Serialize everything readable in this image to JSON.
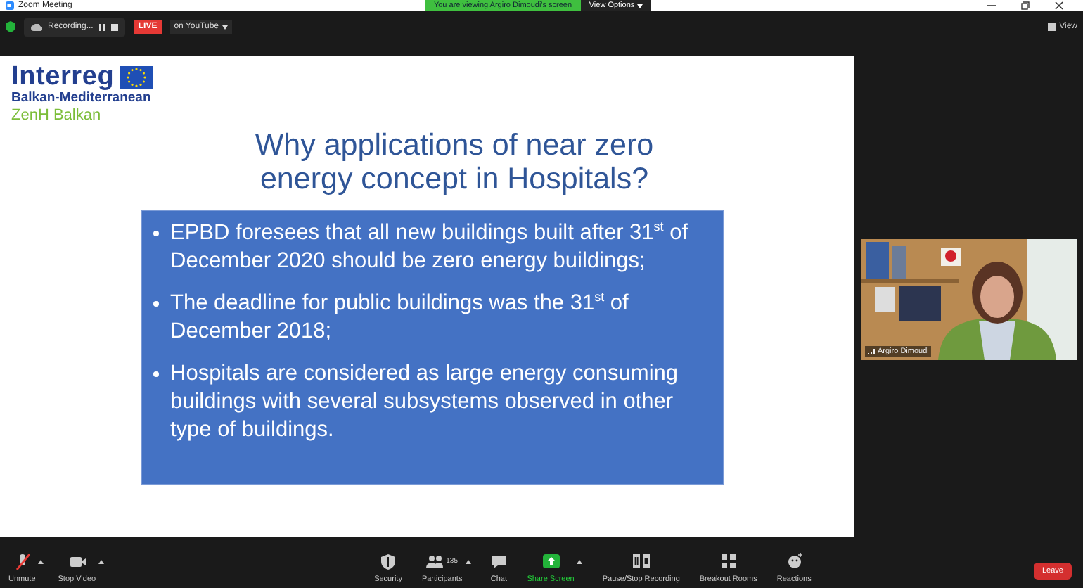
{
  "window": {
    "title": "Zoom Meeting"
  },
  "share_banner": {
    "text": "You are viewing Argiro Dimoudi's screen",
    "options": "View Options"
  },
  "top_bar": {
    "recording": "Recording...",
    "live": "LIVE",
    "live_target": "on YouTube",
    "view": "View"
  },
  "slide": {
    "logo": {
      "brand": "Interreg",
      "program": "Balkan-Mediterranean",
      "project": "ZenH Balkan"
    },
    "title": "Why applications of near zero energy concept in Hospitals?",
    "bullets": [
      "EPBD foresees that all new buildings built after 31$^{st}$  of December 2020 should be zero energy buildings;",
      "The deadline for public buildings was the 31$^{st}$ of December 2018;",
      "Hospitals are considered as large energy consuming buildings with several subsystems observed in other type of buildings."
    ]
  },
  "video": {
    "kind": "picture",
    "name": "Argiro Dimoudi"
  },
  "toolbar": {
    "items": [
      {
        "kind": "mic",
        "label": "Unmute",
        "menu": true
      },
      {
        "kind": "camera",
        "label": "Stop Video",
        "menu": true
      },
      {
        "kind": "security",
        "label": "Security",
        "menu": false
      },
      {
        "kind": "participants",
        "label": "Participants",
        "count": "135",
        "menu": true
      },
      {
        "kind": "chat",
        "label": "Chat",
        "menu": false
      },
      {
        "kind": "share",
        "label": "Share Screen",
        "menu": true
      },
      {
        "kind": "recording",
        "label": "Pause/Stop Recording",
        "menu": false
      },
      {
        "kind": "breakout",
        "label": "Breakout Rooms",
        "menu": false
      },
      {
        "kind": "reactions",
        "label": "Reactions",
        "menu": false
      }
    ],
    "leave": "Leave"
  }
}
